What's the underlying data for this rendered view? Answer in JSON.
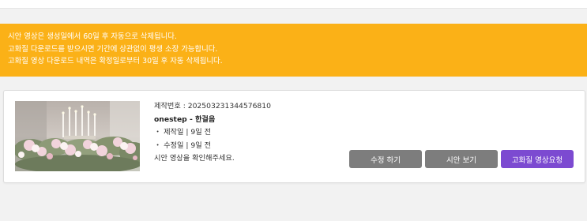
{
  "notice": {
    "lines": [
      "시안 영상은 생성일에서 60일 후 자동으로 삭제됩니다.",
      "고화질 다운로드를 받으시면 기간에 상관없이 평생 소장 가능합니다.",
      "고화질 영상 다운로드 내역은 확정일로부터 30일 후 자동 삭제됩니다."
    ],
    "color": "#fbb117"
  },
  "order": {
    "number_label": "제작번호 : 202503231344576810",
    "title": "onestep - 한걸음",
    "created": "・ 제작일 | 9일 전",
    "modified": "・ 수정일 | 9일 전",
    "status": "시안 영상을 확인해주세요."
  },
  "buttons": {
    "edit": "수정 하기",
    "preview": "시안 보기",
    "hq_request": "고화질 영상요청"
  },
  "colors": {
    "button_gray": "#7d7d7d",
    "button_purple": "#7c4ad1"
  }
}
